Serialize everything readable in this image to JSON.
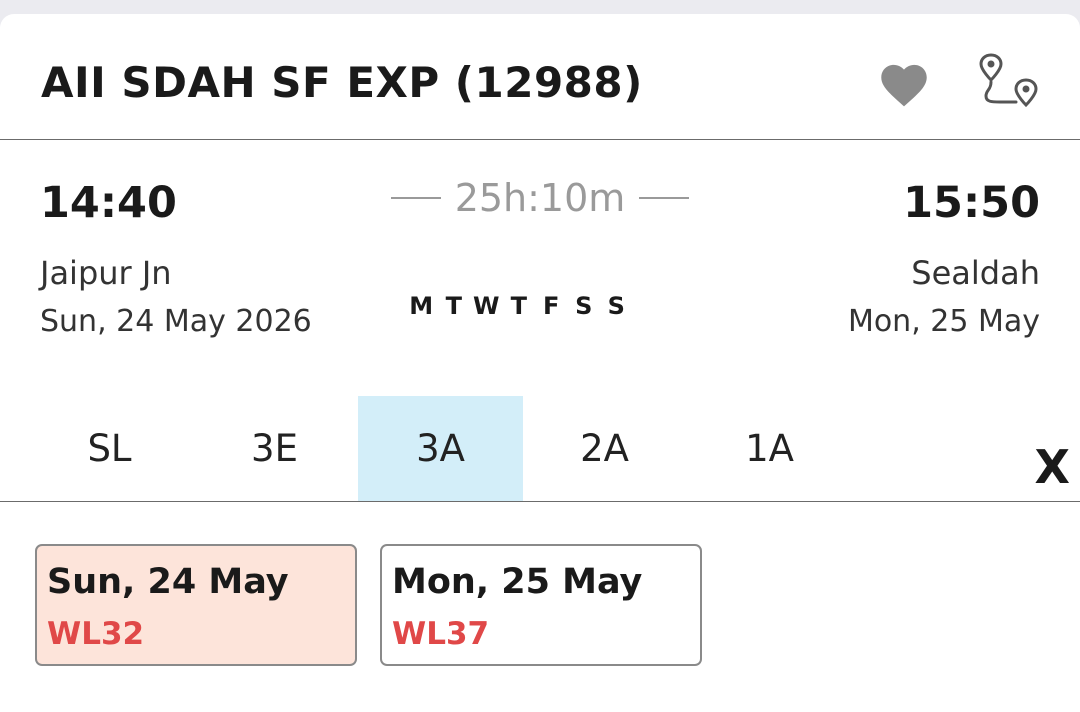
{
  "train": {
    "title": "AII SDAH SF EXP (12988)"
  },
  "journey": {
    "departure": {
      "time": "14:40",
      "station": "Jaipur Jn",
      "date": "Sun, 24 May  2026"
    },
    "arrival": {
      "time": "15:50",
      "station": "Sealdah",
      "date": "Mon, 25 May"
    },
    "duration": "25h:10m",
    "run_days": [
      "M",
      "T",
      "W",
      "T",
      "F",
      "S",
      "S"
    ]
  },
  "classes": {
    "items": [
      "SL",
      "3E",
      "3A",
      "2A",
      "1A"
    ],
    "selected": "3A",
    "close_label": "X"
  },
  "availability": [
    {
      "date": "Sun, 24 May",
      "status": "WL32",
      "selected": true
    },
    {
      "date": "Mon, 25 May",
      "status": "WL37",
      "selected": false
    }
  ],
  "icons": {
    "favorite": "heart-icon",
    "route": "route-map-icon"
  },
  "colors": {
    "selected_tab": "#d3eef9",
    "selected_card": "#fde4da",
    "waitlist": "#e04848",
    "icon_gray": "#8a8a8a"
  }
}
